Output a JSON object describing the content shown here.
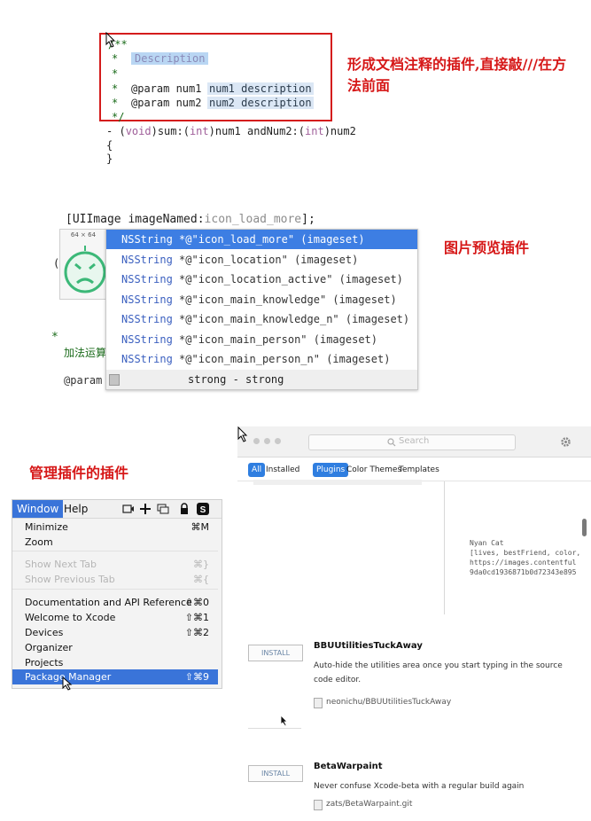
{
  "doc_comment": {
    "open": "/**",
    "star": "*",
    "description": "Description",
    "param1_name": "@param num1",
    "param1_desc": "num1 description",
    "param2_name": "@param num2",
    "param2_desc": "num2 description",
    "close": "*/",
    "sig_prefix": "- (",
    "sig_void": "void",
    "sig_mid": ")sum:(",
    "sig_int1": "int",
    "sig_mid2": ")num1 andNum2:(",
    "sig_int2": "int",
    "sig_end": ")num2",
    "brace_open": "{",
    "brace_close": "}",
    "caption": "形成文档注释的插件,直接敲///在方法前面"
  },
  "autocomplete": {
    "source_prefix": "[UIImage imageNamed:",
    "source_arg": "icon_load_more",
    "source_suffix": "];",
    "preview_size": "64 × 64",
    "left_paren": "(v",
    "comment_star": "*",
    "comment_text": "加法运算",
    "comment_param": "@param",
    "type_label": "NSString",
    "items": [
      "@\"icon_load_more\" (imageset)",
      "@\"icon_location\" (imageset)",
      "@\"icon_location_active\" (imageset)",
      "@\"icon_main_knowledge\" (imageset)",
      "@\"icon_main_knowledge_n\" (imageset)",
      "@\"icon_main_person\" (imageset)",
      "@\"icon_main_person_n\" (imageset)"
    ],
    "star": "*",
    "footer": "strong - strong",
    "caption": "图片预览插件",
    "colors": {
      "selected": "#3d7ee3"
    }
  },
  "window_menu": {
    "caption": "管理插件的插件",
    "bar_window": "Window",
    "bar_help": "Help",
    "items": [
      {
        "label": "Minimize",
        "shortcut": "⌘M"
      },
      {
        "label": "Zoom",
        "shortcut": ""
      },
      {
        "label": "Show Next Tab",
        "shortcut": "⌘}"
      },
      {
        "label": "Show Previous Tab",
        "shortcut": "⌘{"
      },
      {
        "label": "Documentation and API Reference",
        "shortcut": "⇧⌘0"
      },
      {
        "label": "Welcome to Xcode",
        "shortcut": "⇧⌘1"
      },
      {
        "label": "Devices",
        "shortcut": "⇧⌘2"
      },
      {
        "label": "Organizer",
        "shortcut": ""
      },
      {
        "label": "Projects",
        "shortcut": ""
      },
      {
        "label": "Package Manager",
        "shortcut": "⇧⌘9"
      }
    ]
  },
  "package_manager": {
    "search_placeholder": "Search",
    "tabs": {
      "all": "All",
      "installed": "Installed",
      "plugins": "Plugins",
      "color_themes": "Color Themes",
      "templates": "Templates"
    },
    "nyan": {
      "title": "Nyan Cat",
      "line1": "[lives, bestFriend, color,",
      "line2": "https://images.contentful",
      "line3": "9da0cd1936871b0d72343e895"
    },
    "packages": [
      {
        "title": "BBUUtilitiesTuckAway",
        "desc": "Auto-hide the utilities area once you start typing in the source code editor.",
        "repo": "neonichu/BBUUtilitiesTuckAway",
        "button": "INSTALL"
      },
      {
        "title": "BetaWarpaint",
        "desc": "Never confuse Xcode-beta with a regular build again",
        "repo": "zats/BetaWarpaint.git",
        "button": "INSTALL"
      }
    ]
  }
}
